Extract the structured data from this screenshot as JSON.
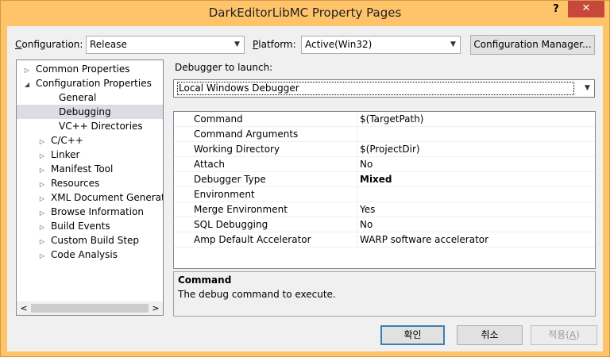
{
  "window": {
    "title": "DarkEditorLibMC Property Pages",
    "help_label": "?",
    "close_label": "✕"
  },
  "config": {
    "label_prefix": "",
    "label_key": "C",
    "label_rest": "onfiguration:",
    "value": "Release",
    "platform_label_key": "P",
    "platform_label_rest": "latform:",
    "platform_value": "Active(Win32)",
    "manager_button": "Configuration Manager..."
  },
  "debugger": {
    "label": "Debugger to launch:",
    "value": "Local Windows Debugger"
  },
  "tree": {
    "items": [
      {
        "label": "Common Properties",
        "twisty": "▷",
        "level": 0
      },
      {
        "label": "Configuration Properties",
        "twisty": "◢",
        "level": 0
      },
      {
        "label": "General",
        "twisty": "",
        "level": 1
      },
      {
        "label": "Debugging",
        "twisty": "",
        "level": 1,
        "selected": true
      },
      {
        "label": "VC++ Directories",
        "twisty": "",
        "level": 1
      },
      {
        "label": "C/C++",
        "twisty": "▷",
        "level": 1
      },
      {
        "label": "Linker",
        "twisty": "▷",
        "level": 1
      },
      {
        "label": "Manifest Tool",
        "twisty": "▷",
        "level": 1
      },
      {
        "label": "Resources",
        "twisty": "▷",
        "level": 1
      },
      {
        "label": "XML Document Generator",
        "twisty": "▷",
        "level": 1
      },
      {
        "label": "Browse Information",
        "twisty": "▷",
        "level": 1
      },
      {
        "label": "Build Events",
        "twisty": "▷",
        "level": 1
      },
      {
        "label": "Custom Build Step",
        "twisty": "▷",
        "level": 1
      },
      {
        "label": "Code Analysis",
        "twisty": "▷",
        "level": 1
      }
    ],
    "scroll_left": "<",
    "scroll_right": ">"
  },
  "properties": [
    {
      "name": "Command",
      "value": "$(TargetPath)"
    },
    {
      "name": "Command Arguments",
      "value": ""
    },
    {
      "name": "Working Directory",
      "value": "$(ProjectDir)"
    },
    {
      "name": "Attach",
      "value": "No"
    },
    {
      "name": "Debugger Type",
      "value": "Mixed",
      "bold": true
    },
    {
      "name": "Environment",
      "value": ""
    },
    {
      "name": "Merge Environment",
      "value": "Yes"
    },
    {
      "name": "SQL Debugging",
      "value": "No"
    },
    {
      "name": "Amp Default Accelerator",
      "value": "WARP software accelerator"
    }
  ],
  "description": {
    "title": "Command",
    "text": "The debug command to execute."
  },
  "buttons": {
    "ok": "확인",
    "cancel": "취소",
    "apply_text": "적용(",
    "apply_key": "A",
    "apply_end": ")"
  },
  "colors": {
    "frame": "#ffc46a",
    "close": "#c7483a",
    "selection": "#dcdce4"
  }
}
